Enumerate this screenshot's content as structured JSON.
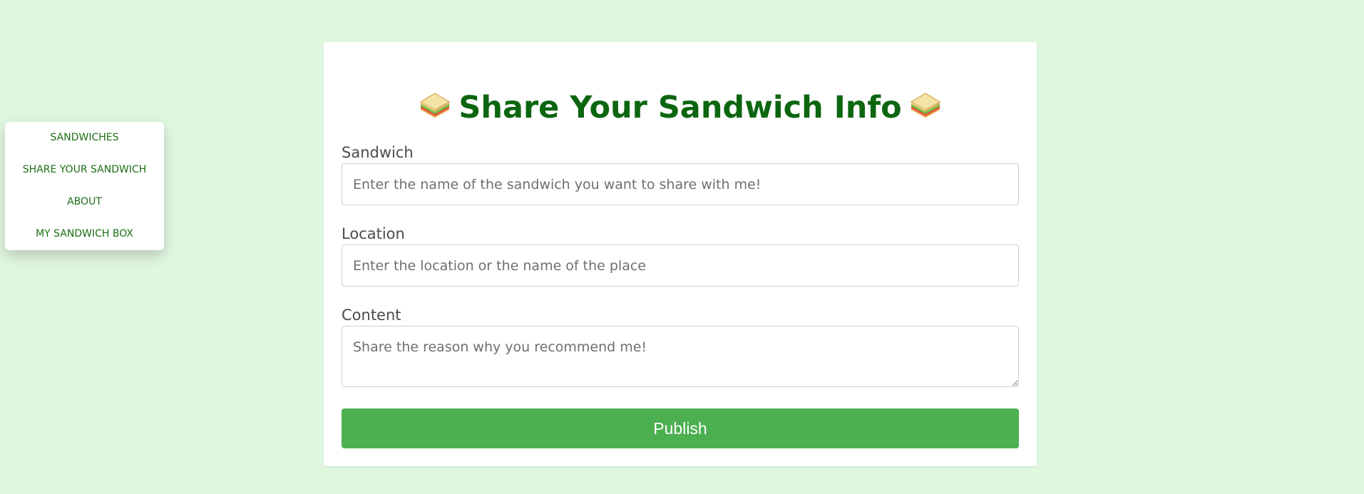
{
  "nav": {
    "items": [
      {
        "label": "SANDWICHES"
      },
      {
        "label": "SHARE YOUR SANDWICH"
      },
      {
        "label": "ABOUT"
      },
      {
        "label": "MY SANDWICH BOX"
      }
    ]
  },
  "form": {
    "title": "Share Your Sandwich Info",
    "title_icon": "sandwich-icon",
    "sandwich": {
      "label": "Sandwich",
      "value": "",
      "placeholder": "Enter the name of the sandwich you want to share with me!"
    },
    "location": {
      "label": "Location",
      "value": "",
      "placeholder": "Enter the location or the name of the place"
    },
    "content": {
      "label": "Content",
      "value": "",
      "placeholder": "Share the reason why you recommend me!"
    },
    "publish_label": "Publish"
  },
  "colors": {
    "background": "#dff6df",
    "title": "#0c6610",
    "nav_text": "#1b6e14",
    "button": "#4caf50"
  }
}
